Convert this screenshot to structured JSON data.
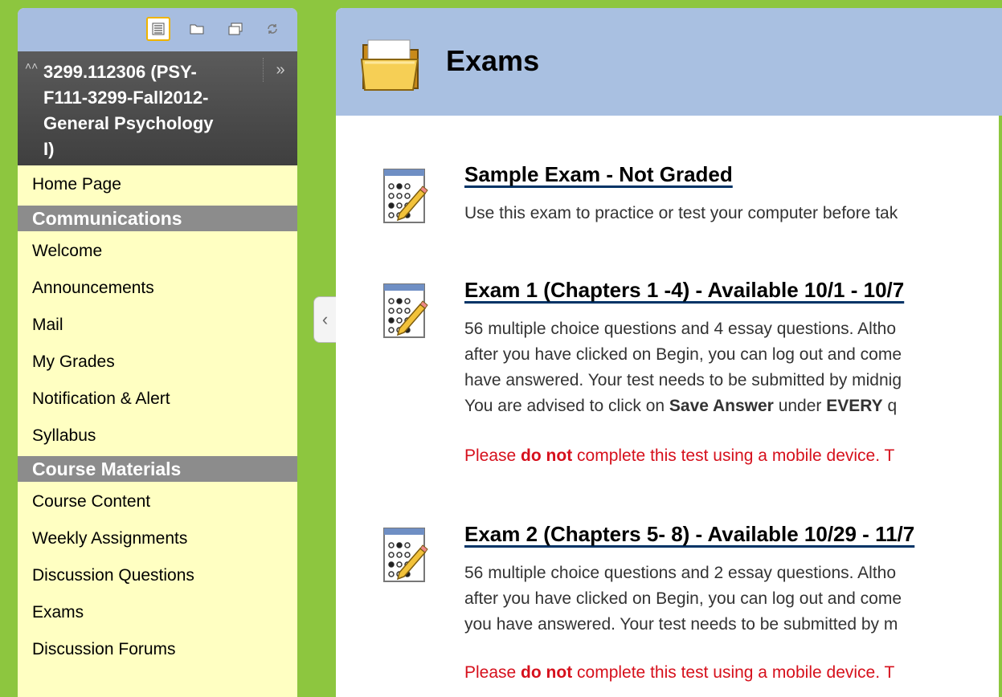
{
  "course": {
    "title": "3299.112306 (PSY-F111-3299-Fall2012-General Psychology I)"
  },
  "view_icons": [
    "list-view-icon",
    "folder-view-icon",
    "window-view-icon",
    "refresh-icon"
  ],
  "menu": {
    "home": "Home Page",
    "sections": [
      {
        "title": "Communications",
        "items": [
          "Welcome",
          "Announcements",
          "Mail",
          "My Grades",
          "Notification & Alert",
          "Syllabus"
        ]
      },
      {
        "title": "Course Materials",
        "items": [
          "Course Content",
          "Weekly Assignments",
          "Discussion Questions",
          "Exams",
          "Discussion Forums"
        ]
      }
    ]
  },
  "page": {
    "title": "Exams"
  },
  "exams": [
    {
      "title": "Sample Exam - Not Graded",
      "desc1": "Use this exam to practice or test your computer before tak"
    },
    {
      "title": "Exam 1 (Chapters 1 -4) - Available 10/1 - 10/7",
      "line1": "56 multiple choice questions and 4 essay questions. Altho",
      "line2": "after you have clicked on Begin, you can log out and come",
      "line3": "have answered. Your test needs to be submitted by midnig",
      "line4_a": "You are advised to click on ",
      "line4_b": "Save Answer",
      "line4_c": " under ",
      "line4_d": "EVERY",
      "line4_e": " q",
      "warn_a": "Please ",
      "warn_b": "do not",
      "warn_c": " complete this test using a mobile device. T"
    },
    {
      "title": "Exam 2 (Chapters 5- 8) - Available 10/29 - 11/7",
      "line1": "56 multiple choice questions and 2 essay questions. Altho",
      "line2": "after you have clicked on Begin, you can log out and come",
      "line3": "you have answered. Your test needs to be submitted by m",
      "warn_a": "Please ",
      "warn_b": "do not",
      "warn_c": " complete this test using a mobile device. T"
    }
  ],
  "colors": {
    "page_bg": "#8dc63f",
    "menu_bg": "#ffffc2",
    "header_blue": "#a9c0e1",
    "section_gray": "#8c8c8c",
    "warning_red": "#d6101c"
  }
}
